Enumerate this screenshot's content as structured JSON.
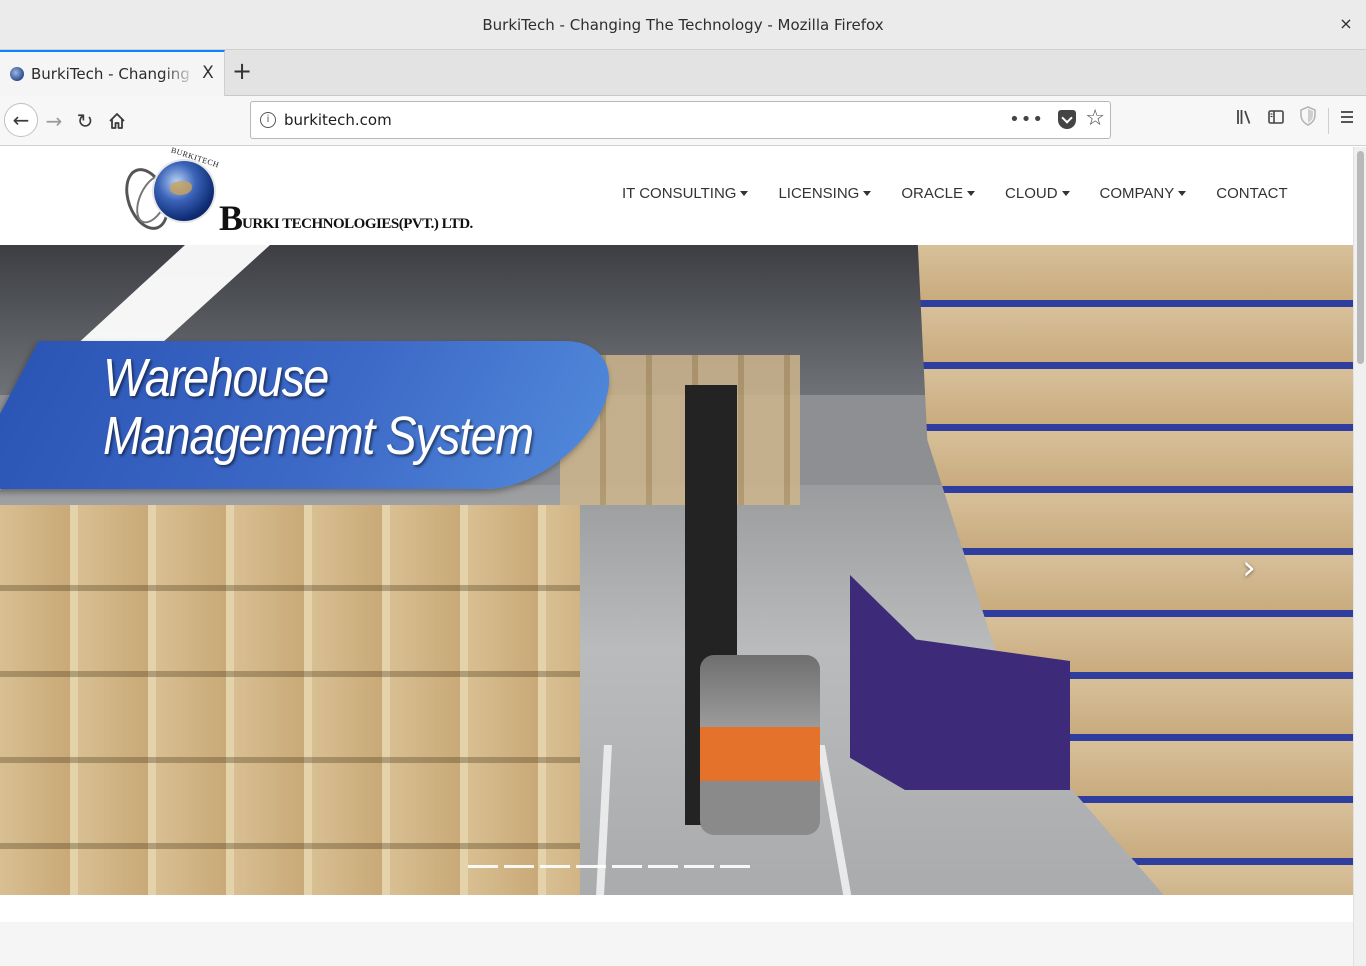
{
  "window": {
    "title": "BurkiTech - Changing The Technology - Mozilla Firefox",
    "close_label": "×"
  },
  "tabs": [
    {
      "label": "BurkiTech - Changing The Technology",
      "close_label": "X"
    }
  ],
  "newtab_label": "+",
  "navbar": {
    "url": "burkitech.com",
    "page_actions_label": "•••"
  },
  "site": {
    "logo": {
      "arc_text": "BURKITECH",
      "initial": "B",
      "rest": "URKI TECHNOLOGIES(PVT.) LTD."
    },
    "nav": [
      {
        "label": "IT CONSULTING",
        "dropdown": true
      },
      {
        "label": "LICENSING",
        "dropdown": true
      },
      {
        "label": "ORACLE",
        "dropdown": true
      },
      {
        "label": "CLOUD",
        "dropdown": true
      },
      {
        "label": "COMPANY",
        "dropdown": true
      },
      {
        "label": "CONTACT",
        "dropdown": false
      }
    ],
    "hero": {
      "line1": "Warehouse",
      "line2": "Managememt System",
      "next_label": "›",
      "slide_count": 8
    }
  },
  "colors": {
    "accent": "#0a84ff",
    "banner_blue": "#3c68c6"
  }
}
